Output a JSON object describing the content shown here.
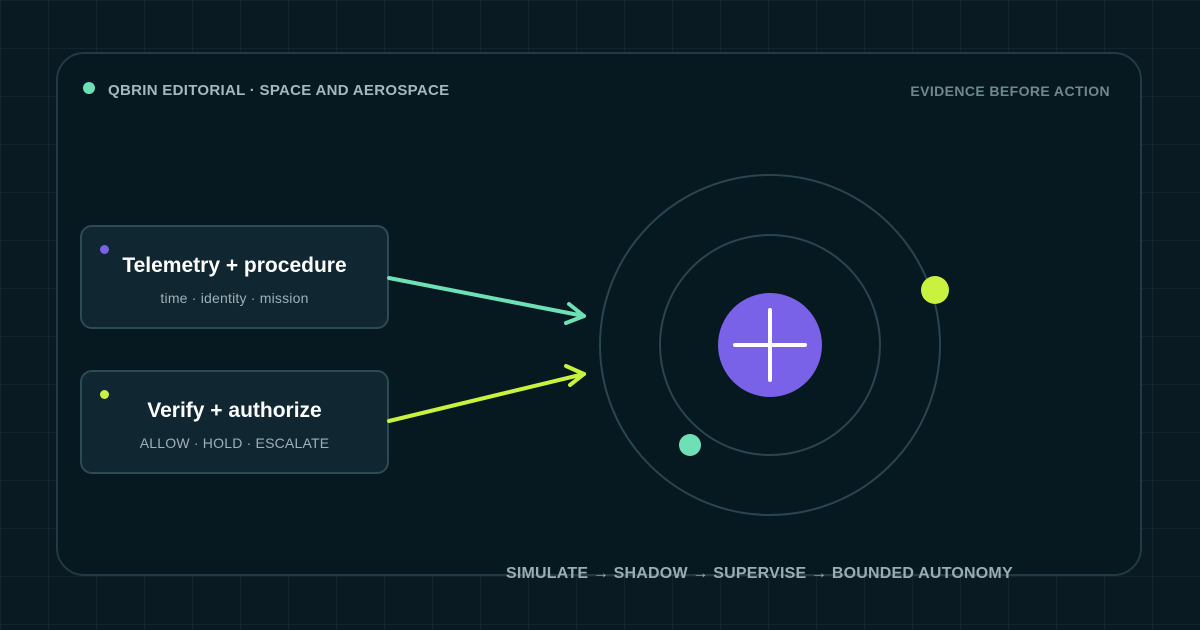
{
  "header": {
    "brand": "QBRIN EDITORIAL · SPACE AND AEROSPACE",
    "tagline": "EVIDENCE BEFORE ACTION"
  },
  "cards": [
    {
      "title": "Telemetry + procedure",
      "subtitle": "time · identity · mission",
      "dot_color": "#7a62e8"
    },
    {
      "title": "Verify + authorize",
      "subtitle": "ALLOW · HOLD · ESCALATE",
      "dot_color": "#c8f23e"
    }
  ],
  "footer": {
    "pipeline": "SIMULATE → SHADOW → SUPERVISE → BOUNDED AUTONOMY"
  },
  "colors": {
    "background": "#0a1a22",
    "frame": "#061820",
    "accent_teal": "#6fe0b6",
    "accent_lime": "#c8f23e",
    "accent_purple": "#7a62e8"
  },
  "icons": {
    "hub": "plus-icon"
  }
}
